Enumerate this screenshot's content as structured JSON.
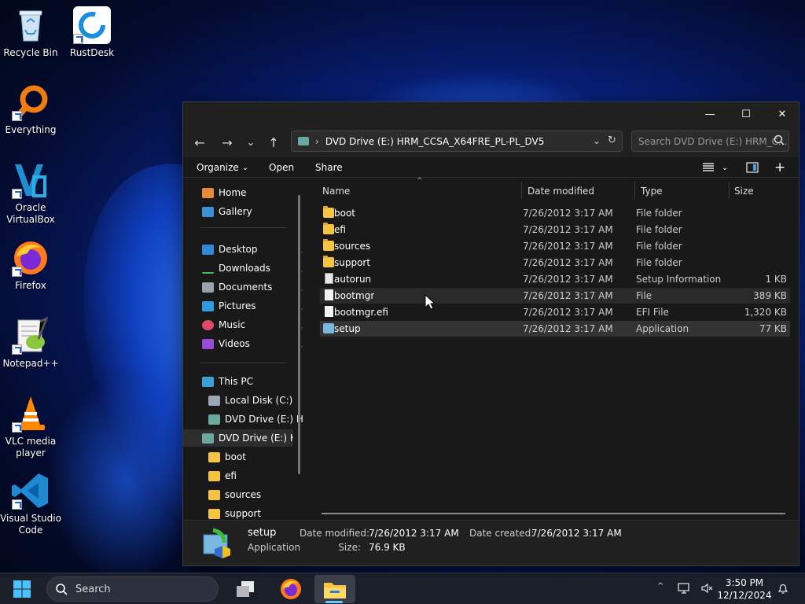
{
  "desktop": {
    "icons": [
      {
        "label": "Recycle Bin"
      },
      {
        "label": "RustDesk"
      },
      {
        "label": "Everything"
      },
      {
        "label": "Oracle VirtualBox"
      },
      {
        "label": "Firefox"
      },
      {
        "label": "Notepad++"
      },
      {
        "label": "VLC media player"
      },
      {
        "label": "Visual Studio Code"
      }
    ]
  },
  "window": {
    "controls": {
      "minimize": "—",
      "maximize": "☐",
      "close": "✕"
    },
    "nav": {
      "back": "←",
      "forward": "→",
      "recent": "⌄",
      "up": "↑"
    },
    "address": {
      "path": "DVD Drive (E:) HRM_CCSA_X64FRE_PL-PL_DV5",
      "chevron": "›"
    },
    "search": {
      "placeholder": "Search DVD Drive (E:) HRM_C..."
    },
    "toolbar": {
      "organize": "Organize",
      "open": "Open",
      "share": "Share"
    },
    "navpane": {
      "home": "Home",
      "gallery": "Gallery",
      "quick": [
        {
          "label": "Desktop"
        },
        {
          "label": "Downloads"
        },
        {
          "label": "Documents"
        },
        {
          "label": "Pictures"
        },
        {
          "label": "Music"
        },
        {
          "label": "Videos"
        }
      ],
      "this_pc": "This PC",
      "local_disk": "Local Disk (C:)",
      "dvd_child": "DVD Drive (E:) H",
      "dvd_selected": "DVD Drive (E:) HR",
      "folders": [
        "boot",
        "efi",
        "sources",
        "support"
      ]
    },
    "columns": {
      "name": "Name",
      "date": "Date modified",
      "type": "Type",
      "size": "Size"
    },
    "files": [
      {
        "name": "boot",
        "date": "7/26/2012 3:17 AM",
        "type": "File folder",
        "size": "",
        "kind": "folder"
      },
      {
        "name": "efi",
        "date": "7/26/2012 3:17 AM",
        "type": "File folder",
        "size": "",
        "kind": "folder"
      },
      {
        "name": "sources",
        "date": "7/26/2012 3:17 AM",
        "type": "File folder",
        "size": "",
        "kind": "folder"
      },
      {
        "name": "support",
        "date": "7/26/2012 3:17 AM",
        "type": "File folder",
        "size": "",
        "kind": "folder"
      },
      {
        "name": "autorun",
        "date": "7/26/2012 3:17 AM",
        "type": "Setup Information",
        "size": "1 KB",
        "kind": "inf"
      },
      {
        "name": "bootmgr",
        "date": "7/26/2012 3:17 AM",
        "type": "File",
        "size": "389 KB",
        "kind": "file"
      },
      {
        "name": "bootmgr.efi",
        "date": "7/26/2012 3:17 AM",
        "type": "EFI File",
        "size": "1,320 KB",
        "kind": "file"
      },
      {
        "name": "setup",
        "date": "7/26/2012 3:17 AM",
        "type": "Application",
        "size": "77 KB",
        "kind": "app"
      }
    ],
    "details": {
      "name": "setup",
      "kind": "Application",
      "modified_label": "Date modified:",
      "modified_value": "7/26/2012 3:17 AM",
      "size_label": "Size:",
      "size_value": "76.9 KB",
      "created_label": "Date created:",
      "created_value": "7/26/2012 3:17 AM"
    }
  },
  "taskbar": {
    "search_label": "Search",
    "time": "3:50 PM",
    "date": "12/12/2024",
    "tray_chevron": "^"
  }
}
